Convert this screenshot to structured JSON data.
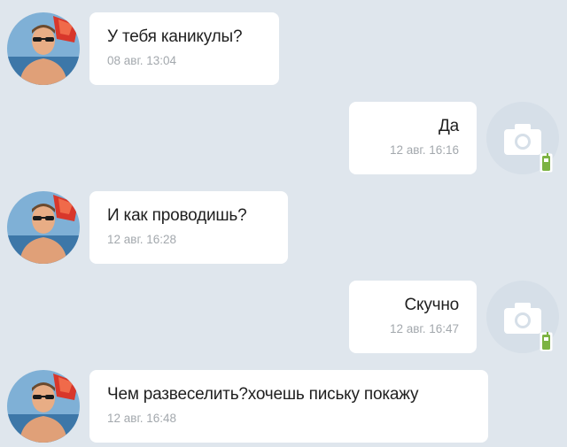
{
  "messages": [
    {
      "direction": "incoming",
      "text": "У тебя каникулы?",
      "time": "08 авг. 13:04",
      "avatar_icon": "user-photo-avatar"
    },
    {
      "direction": "outgoing",
      "text": "Да",
      "time": "12 авг. 16:16",
      "avatar_icon": "camera-icon",
      "status_icon": "mobile-phone-icon",
      "status_color": "#7cb342"
    },
    {
      "direction": "incoming",
      "text": "И как проводишь?",
      "time": "12 авг. 16:28",
      "avatar_icon": "user-photo-avatar"
    },
    {
      "direction": "outgoing",
      "text": "Скучно",
      "time": "12 авг. 16:47",
      "avatar_icon": "camera-icon",
      "status_icon": "mobile-phone-icon",
      "status_color": "#7cb342"
    },
    {
      "direction": "incoming",
      "text": "Чем развеселить?хочешь письку покажу",
      "time": "12 авг. 16:48",
      "avatar_icon": "user-photo-avatar"
    }
  ],
  "colors": {
    "background": "#dfe6ed",
    "bubble": "#ffffff",
    "text": "#1f1f1f",
    "time": "#a3a8ad",
    "camera_placeholder": "#d6dfe8",
    "mobile_badge": "#7cb342"
  }
}
